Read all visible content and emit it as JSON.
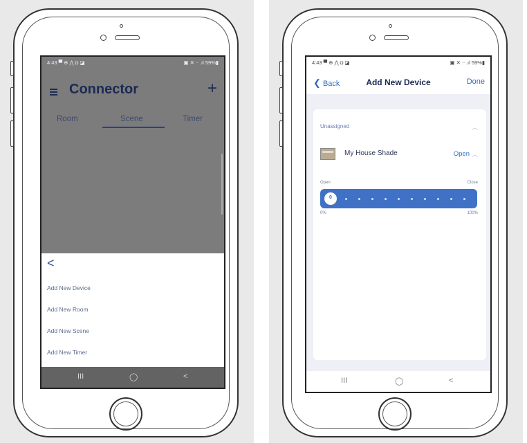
{
  "left_phone": {
    "status_time": "4:43",
    "status_icons_left": "▀ ⊕ ⋀ ◘ ◪",
    "status_right": "▣ ✕ ᐧᐧ .ıl 59%▮",
    "app_title": "Connector",
    "add_icon": "plus-icon",
    "tabs": [
      "Room",
      "Scene",
      "Timer"
    ],
    "active_tab": "Scene",
    "back_glyph": "<",
    "menu_items": [
      "Add New Device",
      "Add New Room",
      "Add New Scene",
      "Add New Timer"
    ],
    "nav": {
      "recents": "III",
      "home": "◯",
      "back": "<"
    }
  },
  "right_phone": {
    "status_time": "4:43",
    "status_icons_left": "▀ ⊕ ⋀ ◘ ◪",
    "status_right": "▣ ✕ ᐧᐧ .ıl 59%▮",
    "back_label": "Back",
    "title": "Add New Device",
    "done_label": "Done",
    "group_label": "Unassigned",
    "device_name": "My House Shade",
    "device_status": "Open",
    "slider": {
      "left_label": "Open",
      "right_label": "Close",
      "knob_value": "0",
      "min_label": "0%",
      "max_label": "100%",
      "position_percent": 0
    },
    "nav": {
      "recents": "III",
      "home": "◯",
      "back": "<"
    }
  },
  "colors": {
    "brand_navy": "#1b2a55",
    "accent_blue": "#3f72c6",
    "link_blue": "#2f6bc2",
    "panel_bg": "#e9e9e9",
    "overlay_gray": "#7c7c7c"
  }
}
